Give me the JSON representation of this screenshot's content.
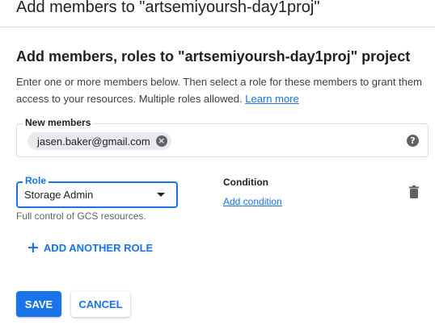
{
  "dialog": {
    "title": "Add members to \"artsemiyoursh-day1proj\""
  },
  "section": {
    "title": "Add members, roles to \"artsemiyoursh-day1proj\" project",
    "description": "Enter one or more members below. Then select a role for these members to grant them access to your resources. Multiple roles allowed.",
    "learn_more": "Learn more"
  },
  "members": {
    "label": "New members",
    "chips": [
      "jasen.baker@gmail.com"
    ],
    "help_icon": "help-icon"
  },
  "role": {
    "label": "Role",
    "value": "Storage Admin",
    "hint": "Full control of GCS resources."
  },
  "condition": {
    "label": "Condition",
    "add_label": "Add condition"
  },
  "add_role_label": "ADD ANOTHER ROLE",
  "buttons": {
    "save": "SAVE",
    "cancel": "CANCEL"
  },
  "colors": {
    "accent": "#1a73e8",
    "chip_bg": "#e8eaed",
    "text": "#202124"
  }
}
